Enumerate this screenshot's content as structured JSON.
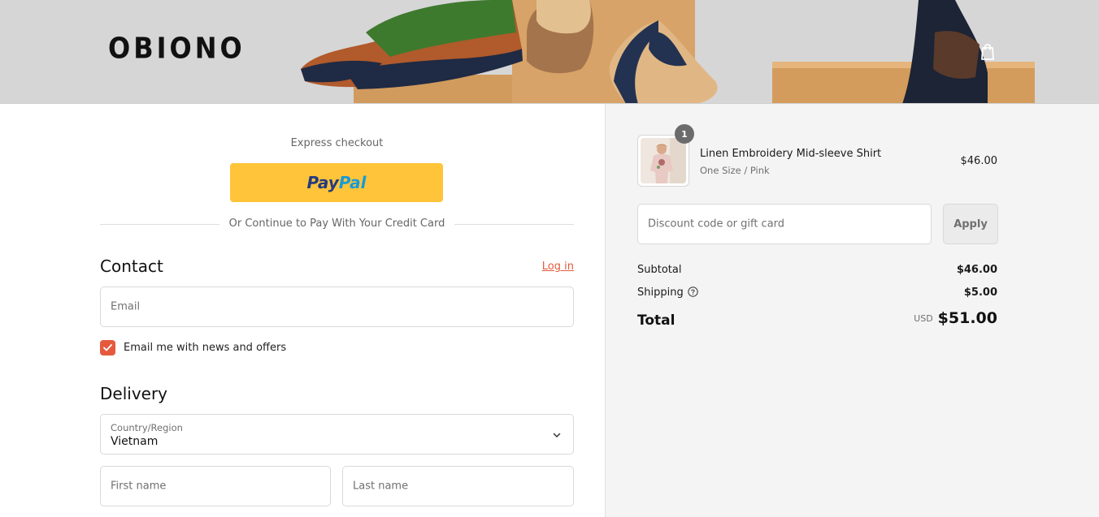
{
  "header": {
    "logo": "OBIONO"
  },
  "express": {
    "title": "Express checkout",
    "paypal_part1": "Pay",
    "paypal_part2": "Pal",
    "divider_text": "Or Continue to Pay With Your Credit Card"
  },
  "contact": {
    "title": "Contact",
    "login_link": "Log in",
    "email_placeholder": "Email",
    "newsletter_label": "Email me with news and offers",
    "newsletter_checked": true
  },
  "delivery": {
    "title": "Delivery",
    "country_label": "Country/Region",
    "country_value": "Vietnam",
    "first_name_placeholder": "First name",
    "last_name_placeholder": "Last name"
  },
  "order": {
    "item": {
      "quantity": "1",
      "name": "Linen Embroidery Mid-sleeve Shirt",
      "variant": "One Size / Pink",
      "price": "$46.00"
    },
    "discount_placeholder": "Discount code or gift card",
    "apply_label": "Apply",
    "subtotal_label": "Subtotal",
    "subtotal_value": "$46.00",
    "shipping_label": "Shipping",
    "shipping_value": "$5.00",
    "total_label": "Total",
    "currency": "USD",
    "total_value": "$51.00"
  },
  "colors": {
    "accent": "#e55a3d",
    "paypal_yellow": "#ffc439",
    "summary_bg": "#f4f4f4",
    "banner_bg": "#d6d6d6"
  },
  "icons": [
    "cart-bag-icon",
    "chevron-down-icon",
    "question-circle-icon",
    "checkmark-icon"
  ]
}
